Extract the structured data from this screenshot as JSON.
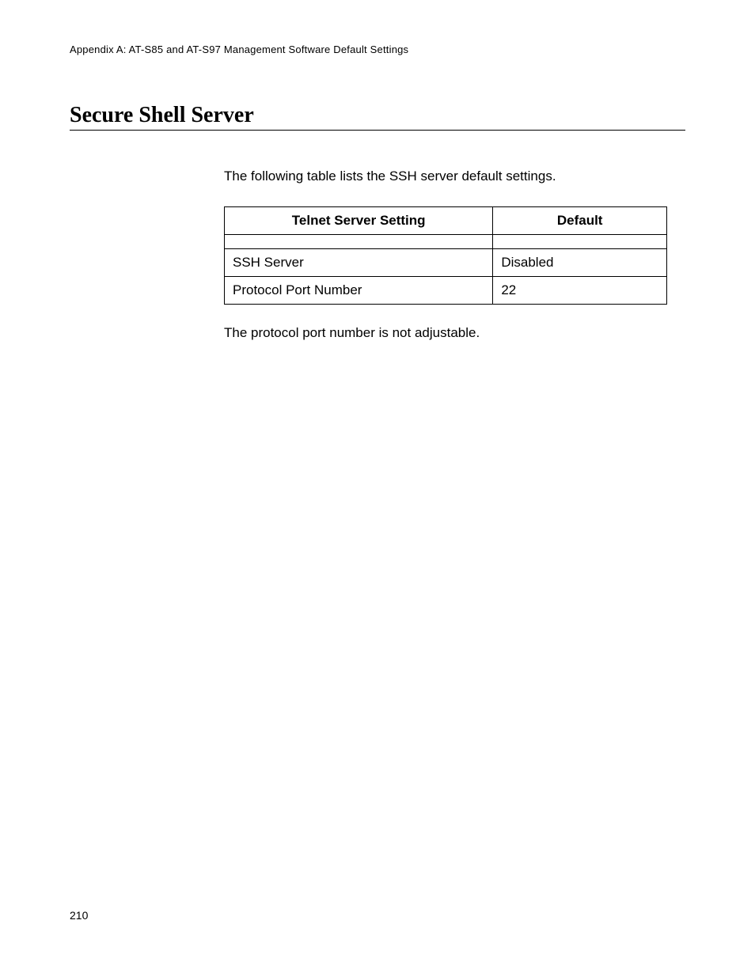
{
  "header": {
    "running": "Appendix A: AT-S85 and AT-S97 Management Software Default Settings"
  },
  "section": {
    "title": "Secure Shell Server",
    "intro": "The following table lists the SSH server default settings.",
    "note": "The protocol port number is not adjustable."
  },
  "table": {
    "headers": {
      "setting": "Telnet Server Setting",
      "default": "Default"
    },
    "rows": [
      {
        "setting": "SSH Server",
        "default": "Disabled"
      },
      {
        "setting": "Protocol Port Number",
        "default": "22"
      }
    ]
  },
  "footer": {
    "page_number": "210"
  }
}
